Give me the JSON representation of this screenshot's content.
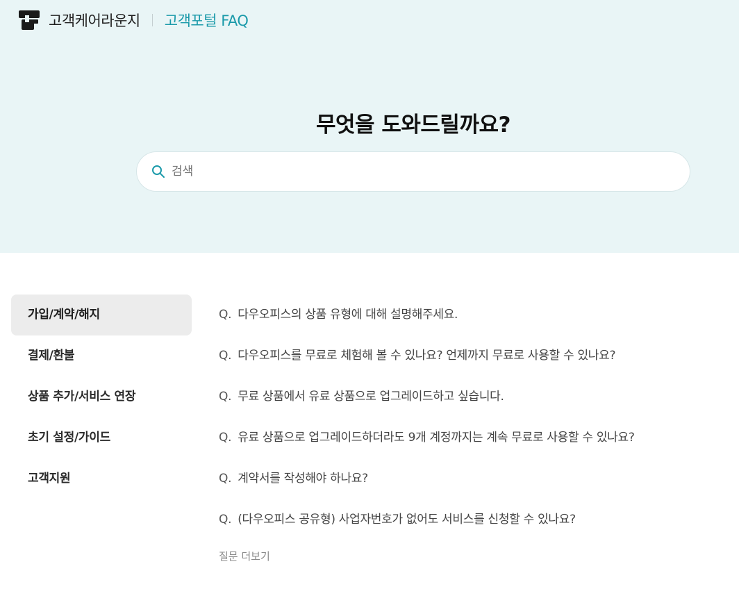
{
  "header": {
    "brand_name": "고객케어라운지",
    "portal_link": "고객포털 FAQ"
  },
  "hero": {
    "title": "무엇을 도와드릴까요?",
    "search_placeholder": "검색"
  },
  "sidebar": {
    "items": [
      {
        "label": "가입/계약/해지",
        "active": true
      },
      {
        "label": "결제/환불"
      },
      {
        "label": "상품 추가/서비스 연장"
      },
      {
        "label": "초기 설정/가이드"
      },
      {
        "label": "고객지원"
      }
    ]
  },
  "faq": {
    "prefix": "Q.",
    "items": [
      "다우오피스의 상품 유형에 대해 설명해주세요.",
      "다우오피스를 무료로 체험해 볼 수 있나요? 언제까지 무료로 사용할 수 있나요?",
      "무료 상품에서 유료 상품으로 업그레이드하고 싶습니다.",
      "유료 상품으로 업그레이드하더라도 9개 계정까지는 계속 무료로 사용할 수 있나요?",
      "계약서를 작성해야 하나요?",
      "(다우오피스 공유형) 사업자번호가 없어도 서비스를 신청할 수 있나요?"
    ],
    "more_label": "질문 더보기"
  },
  "colors": {
    "hero_bg": "#e9f5f6",
    "accent": "#1b9aaa",
    "active_bg": "#ececec"
  },
  "icons": [
    "brand-logo",
    "search-icon"
  ]
}
